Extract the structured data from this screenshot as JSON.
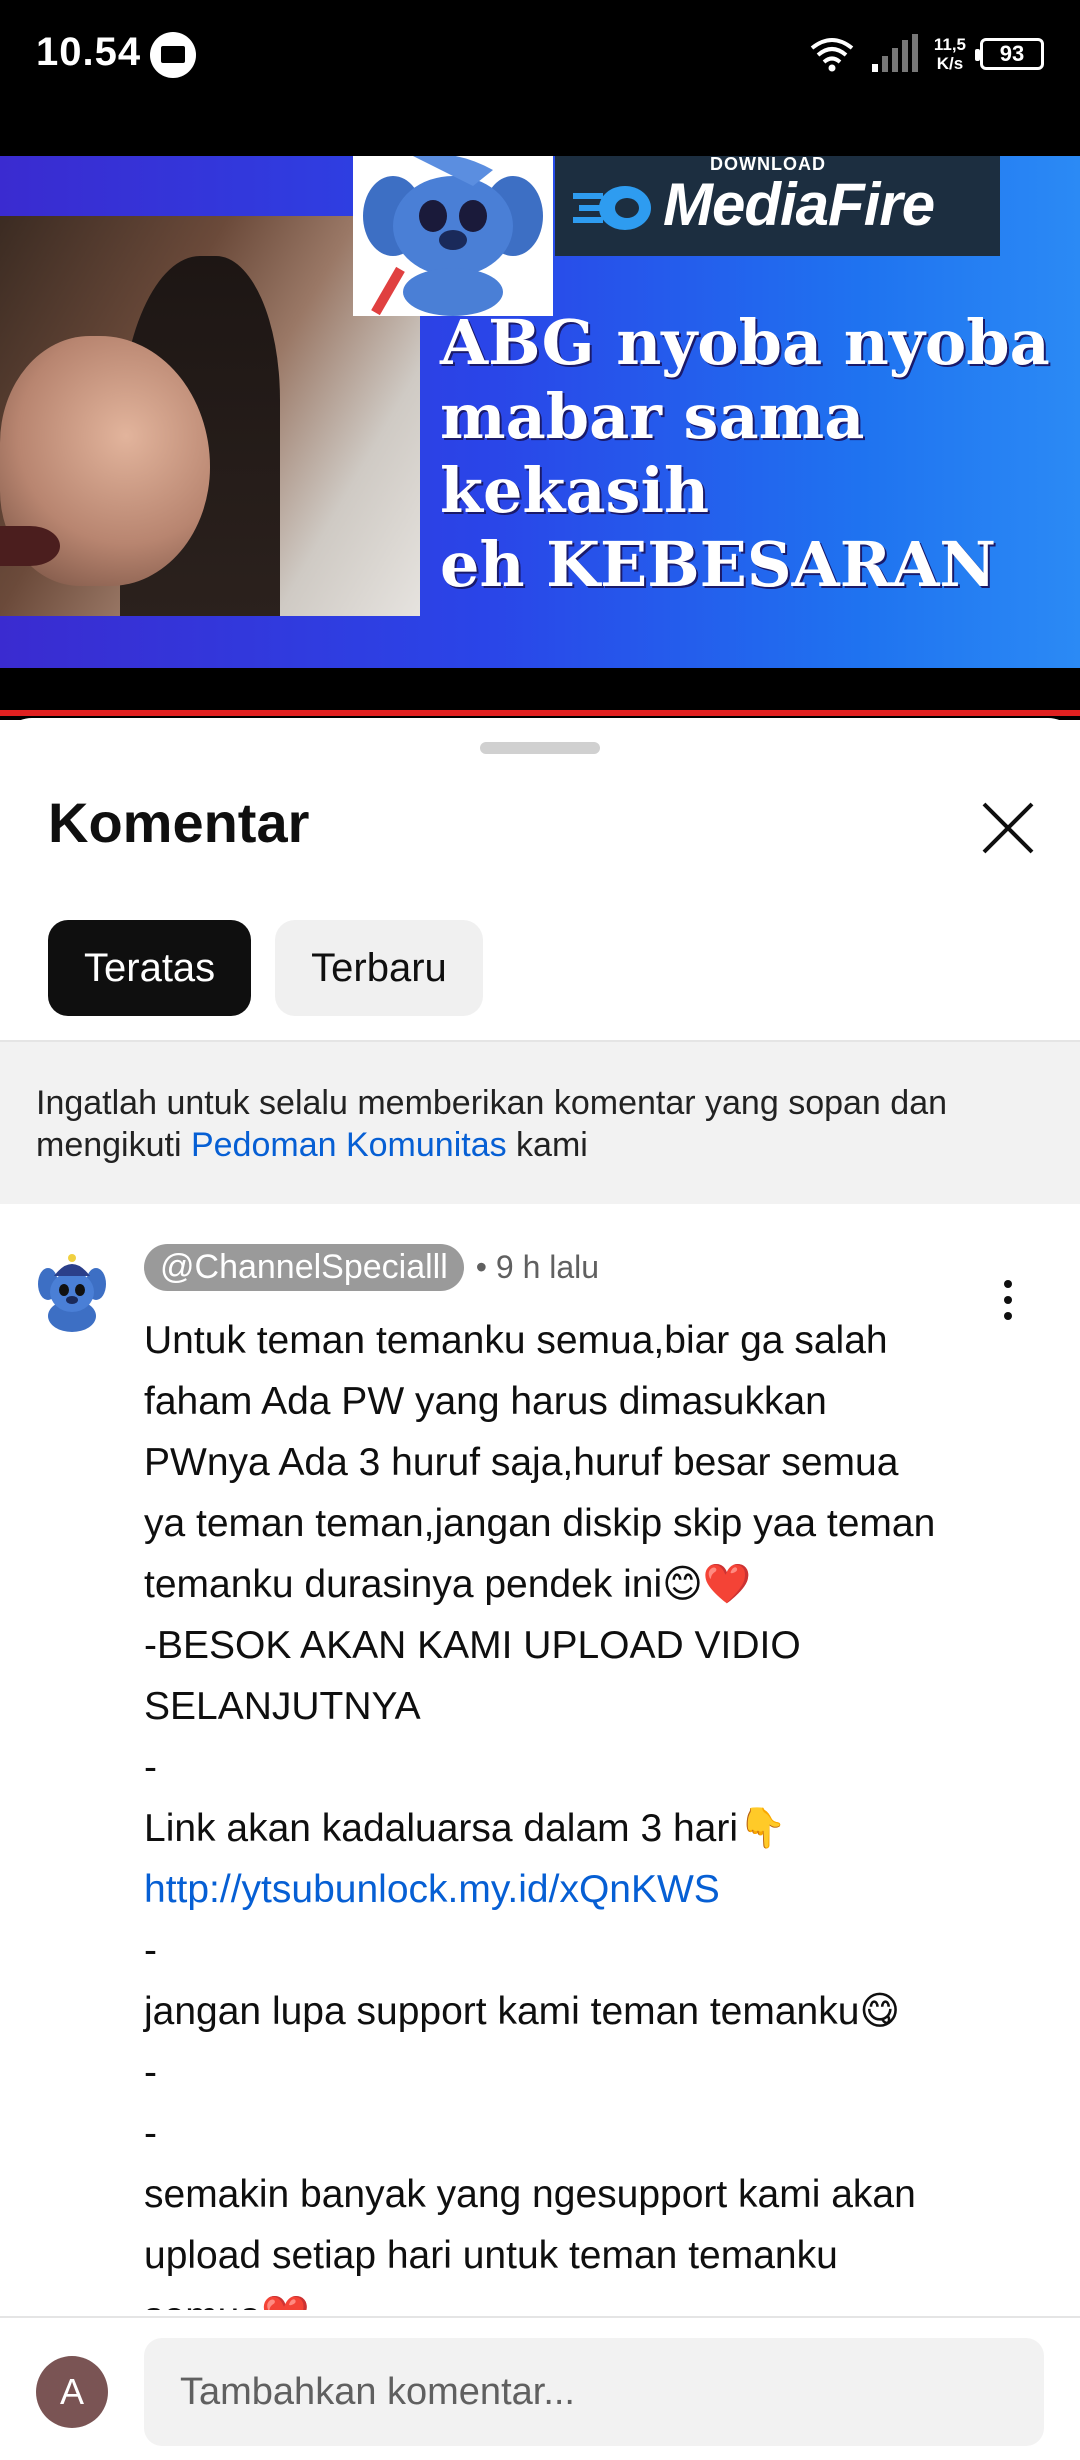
{
  "status_bar": {
    "time": "10.54",
    "net_speed_value": "11,5",
    "net_speed_unit": "K/s",
    "battery": "93"
  },
  "video": {
    "brand_small": "DOWNLOAD",
    "brand_name": "MediaFire",
    "headline_lines": [
      "ABG nyoba nyoba",
      "mabar sama",
      "kekasih",
      "eh KEBESARAN"
    ]
  },
  "comments_sheet": {
    "title": "Komentar",
    "tabs": [
      {
        "label": "Teratas",
        "active": true
      },
      {
        "label": "Terbaru",
        "active": false
      }
    ],
    "notice": {
      "prefix": "Ingatlah untuk selalu memberikan komentar yang sopan dan mengikuti ",
      "link": "Pedoman Komunitas",
      "suffix": " kami"
    },
    "comment": {
      "author": "@ChannelSpecialll",
      "time": "• 9 h lalu",
      "lines": [
        "Untuk teman temanku semua,biar ga salah",
        "faham Ada PW yang harus dimasukkan",
        "PWnya Ada 3 huruf saja,huruf besar semua",
        "ya teman teman,jangan diskip skip yaa teman",
        "temanku durasinya pendek ini😊❤️",
        "-BESOK AKAN KAMI UPLOAD VIDIO",
        "SELANJUTNYA",
        "-",
        "Link akan kadaluarsa dalam 3 hari👇",
        "http://ytsubunlock.my.id/xQnKWS",
        "-",
        "jangan lupa support kami teman temanku😋",
        "-",
        "-",
        "semakin banyak yang ngesupport kami akan",
        "upload setiap hari untuk teman temanku",
        "semua❤️"
      ]
    }
  },
  "input_bar": {
    "avatar_letter": "A",
    "placeholder": "Tambahkan komentar..."
  },
  "colors": {
    "link": "#065fd4",
    "progress": "#e02020",
    "chip_active": "#0f0f0f"
  }
}
